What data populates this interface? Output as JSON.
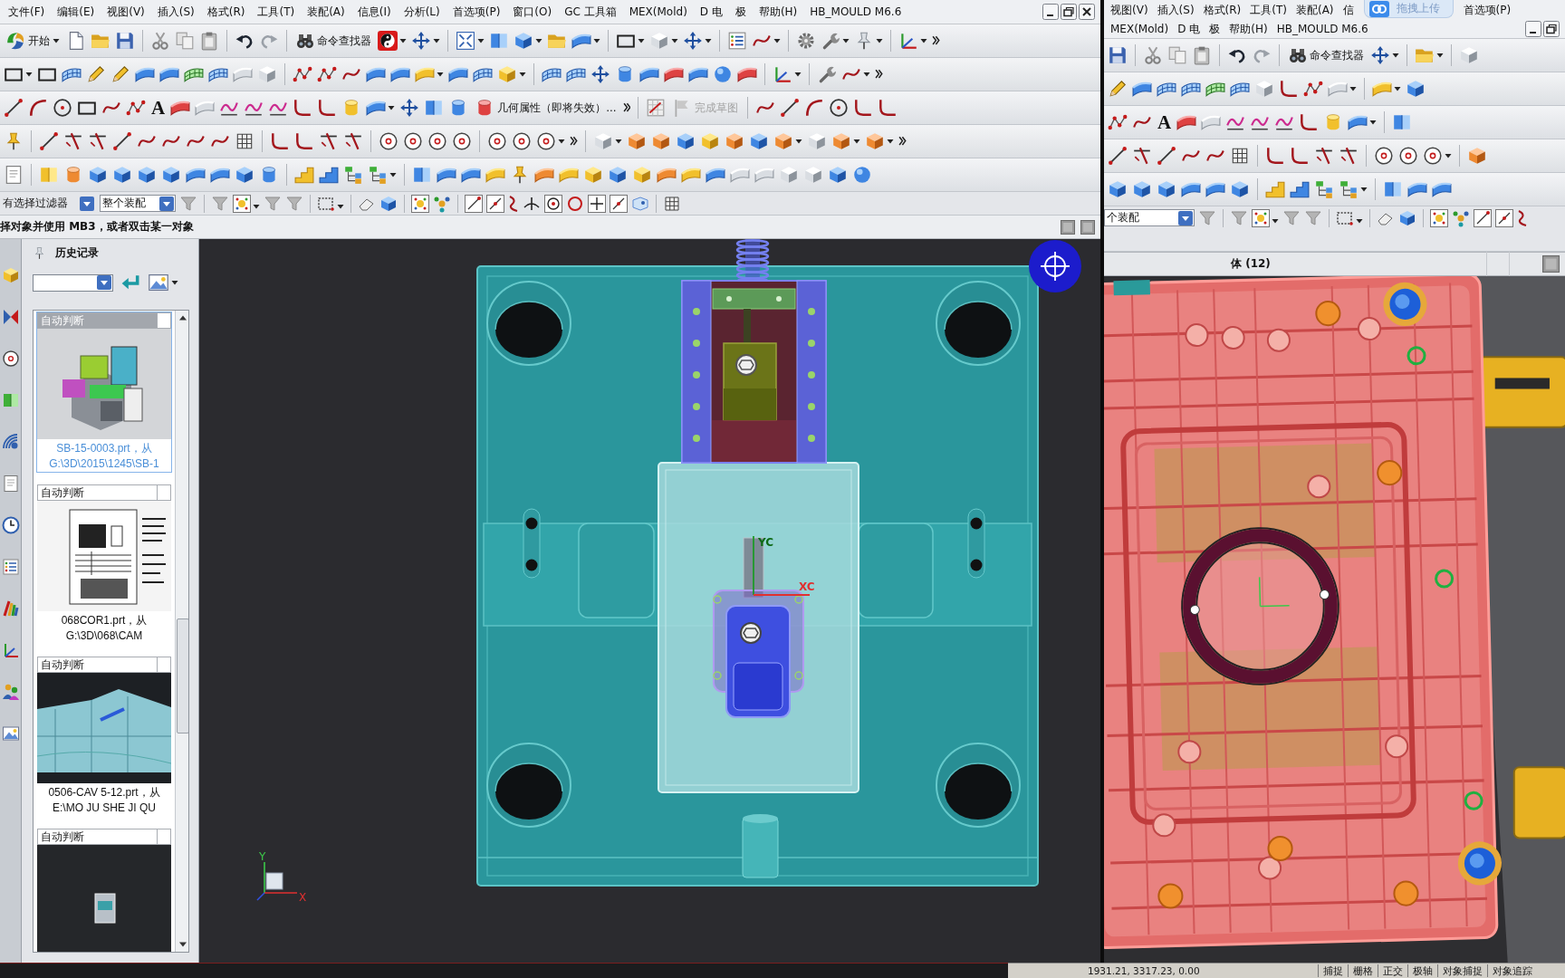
{
  "left_window": {
    "menu_bar": [
      "文件(F)",
      "编辑(E)",
      "视图(V)",
      "插入(S)",
      "格式(R)",
      "工具(T)",
      "装配(A)",
      "信息(I)",
      "分析(L)",
      "首选项(P)",
      "窗口(O)",
      "GC 工具箱",
      "MEX(Mold)",
      "D 电",
      "极",
      "帮助(H)",
      "HB_MOULD M6.6"
    ],
    "toolbar": {
      "start_button": "开始",
      "command_finder": "命令查找器",
      "text_tool": "A",
      "geometry_properties": {
        "label": "几何属性（即将失效）...",
        "disabled": false
      },
      "finish_sketch": {
        "label": "完成草图",
        "disabled": true
      }
    },
    "selection_bar": {
      "type_filter": "有选择过滤器",
      "scope": "整个装配"
    },
    "prompt": "择对象并使用 MB3，或者双击某一对象",
    "history_panel": {
      "title": "历史记录",
      "items": [
        {
          "header": "自动判断",
          "kind": "render",
          "caption": [
            "SB-15-0003.prt，从",
            "G:\\3D\\2015\\1245\\SB-1"
          ],
          "selected": true
        },
        {
          "header": "自动判断",
          "kind": "drawing",
          "caption": [
            "068COR1.prt，从",
            "G:\\3D\\068\\CAM"
          ],
          "selected": false
        },
        {
          "header": "自动判断",
          "kind": "render_dark",
          "caption": [
            "0506-CAV 5-12.prt，从",
            "E:\\MO JU SHE JI QU"
          ],
          "selected": false
        },
        {
          "header": "自动判断",
          "kind": "part_dark",
          "selected": false
        }
      ]
    },
    "viewport": {
      "wcs_labels": {
        "x": "XC",
        "y": "YC"
      },
      "triad_labels": {
        "x": "X",
        "y": "Y"
      }
    }
  },
  "right_window": {
    "menu_bar": {
      "row_1": [
        "视图(V)",
        "插入(S)",
        "格式(R)",
        "工具(T)",
        "装配(A)",
        "信"
      ],
      "upload_widget": {
        "label": "拖拽上传"
      },
      "row_1_end": [
        "首选项(P)"
      ],
      "row_2": [
        "MEX(Mold)",
        "D 电",
        "极",
        "帮助(H)",
        "HB_MOULD M6.6"
      ]
    },
    "toolbar": {
      "command_finder": "命令查找器",
      "text_tool": "A"
    },
    "selection_bar": {
      "scope": "个装配"
    },
    "panel_header": "体 (12)"
  },
  "status_bar": {
    "coordinates": "1931.21, 3317.23, 0.00",
    "toggles": [
      "捕捉",
      "栅格",
      "正交",
      "极轴",
      "对象捕捉",
      "对象追踪"
    ]
  }
}
